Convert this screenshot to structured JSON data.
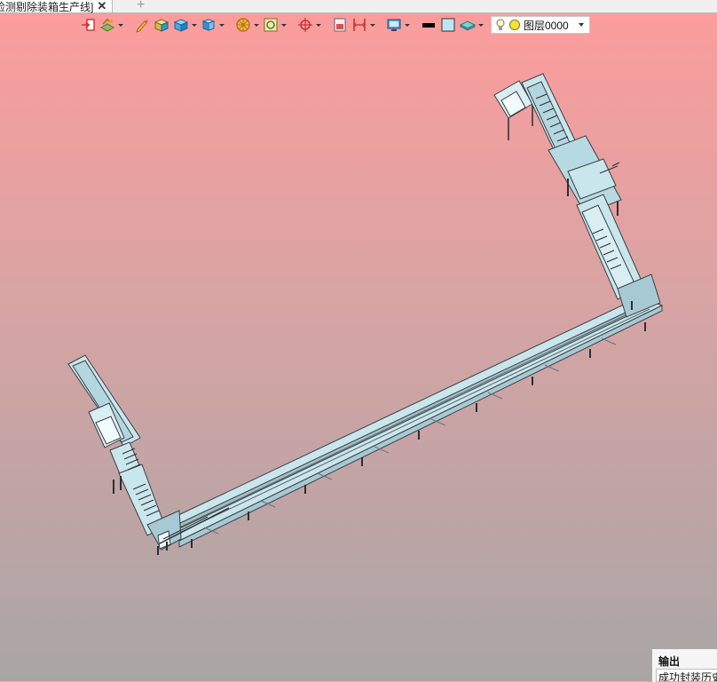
{
  "tab": {
    "title": "检测剔除装箱生产线]",
    "close_glyph": "✕",
    "add_glyph": "+"
  },
  "toolbar": {
    "buttons": [
      {
        "icon": "exit-icon"
      },
      {
        "icon": "layers-paint-icon",
        "dropdown": true
      },
      {
        "icon": "pencil-icon"
      },
      {
        "icon": "box-shade-icon"
      },
      {
        "icon": "cube-view-icon",
        "dropdown": true
      },
      {
        "icon": "cube-display-icon",
        "dropdown": true
      },
      {
        "icon": "render-wheel-icon",
        "dropdown": true
      },
      {
        "icon": "view-frame-icon",
        "dropdown": true
      },
      {
        "icon": "crosshair-icon",
        "dropdown": true
      },
      {
        "icon": "section-icon"
      },
      {
        "icon": "dimension-icon",
        "dropdown": true
      },
      {
        "icon": "monitor-icon",
        "dropdown": true
      },
      {
        "icon": "line-color-icon"
      },
      {
        "icon": "fill-color-icon"
      },
      {
        "icon": "material-icon",
        "dropdown": true
      }
    ],
    "layer_select": {
      "value": "图层0000"
    }
  },
  "output": {
    "title": "输出",
    "message": "成功封装历史"
  },
  "colors": {
    "background_top": "#fe9c9c",
    "background_bottom": "#a9a5a6",
    "model_fill": "#c9e6ec",
    "model_edge": "#3a3f44"
  }
}
